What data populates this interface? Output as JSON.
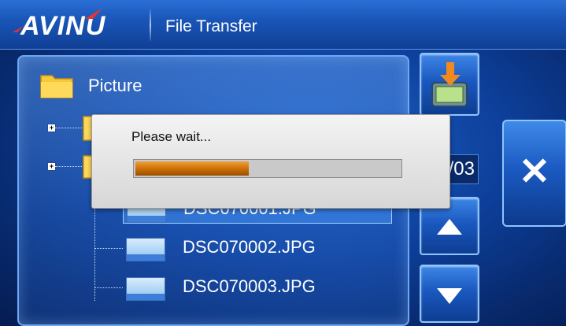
{
  "app": {
    "logo_text": "AVINU",
    "title": "File Transfer"
  },
  "tree": {
    "root_label": "Picture",
    "files": [
      {
        "name": "DSC070001.JPG",
        "selected": true,
        "partially_visible": true
      },
      {
        "name": "DSC070002.JPG",
        "selected": false
      },
      {
        "name": "DSC070003.JPG",
        "selected": false
      }
    ]
  },
  "pager": {
    "page_text": "/03"
  },
  "dialog": {
    "message": "Please wait...",
    "progress": 0.43
  },
  "buttons": {
    "close_glyph": "✕",
    "up_icon": "arrow-up-icon",
    "down_icon": "arrow-down-icon",
    "transfer_icon": "download-to-device-icon"
  },
  "colors": {
    "accent": "#1a56b8",
    "progress": "#c86d04"
  }
}
